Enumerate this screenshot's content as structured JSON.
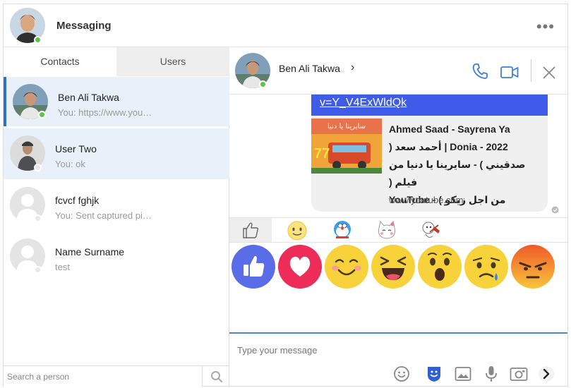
{
  "app": {
    "title": "Messaging",
    "more_icon": "more-horizontal-icon"
  },
  "tabs": [
    {
      "label": "Contacts",
      "active": true
    },
    {
      "label": "Users",
      "active": false
    }
  ],
  "contacts": [
    {
      "name": "Ben Ali Takwa",
      "preview": "You: https://www.you…",
      "status": "online"
    },
    {
      "name": "User Two",
      "preview": "You: ok",
      "status": "offline"
    },
    {
      "name": "fcvcf fghjk",
      "preview": "You: Sent captured pi…",
      "status": "offline"
    },
    {
      "name": "Name Surname",
      "preview": "test",
      "status": "offline"
    }
  ],
  "search": {
    "placeholder": "Search a person",
    "icon": "search-icon"
  },
  "chat": {
    "peer_name": "Ben Ali Takwa",
    "chevron": "›",
    "icons": [
      "phone-icon",
      "video-icon",
      "close-icon"
    ]
  },
  "message": {
    "link_text": "v=Y_V4ExWldQk",
    "preview_title": "Ahmed Saad - Sayrena Ya Donia - 2022 | أحمد سعد ( صدقيني ) - سايرينا يا دنيا من فيلم ( من اجل زيكو ) - YouTube",
    "preview_title_lines": [
      "Ahmed Saad - Sayrena Ya",
      "Donia - 2022 | أحمد سعد (",
      "صدقيني ) - سايرينا يا دنيا من فيلم (",
      "من اجل زيكو ) - YouTube"
    ],
    "preview_domain": "www.youtube.com",
    "thumbnail_text": "سايرينا يا دنيا",
    "thumbnail_number": "77"
  },
  "sticker_tabs": [
    "like-icon",
    "smiley-sticker",
    "doraemon-sticker",
    "cat-sticker",
    "character-sticker"
  ],
  "reactions": [
    {
      "name": "like",
      "color": "#5a6de8"
    },
    {
      "name": "love",
      "color": "#ee2c5a"
    },
    {
      "name": "haha-blush",
      "color": "#f7d23a"
    },
    {
      "name": "laugh",
      "color": "#f7d23a"
    },
    {
      "name": "wow",
      "color": "#f7d23a"
    },
    {
      "name": "sad",
      "color": "#f7d23a"
    },
    {
      "name": "angry",
      "color": "#f07a2a"
    }
  ],
  "composer": {
    "placeholder": "Type your message",
    "tools": [
      "emoji-icon",
      "sticker-icon",
      "image-icon",
      "microphone-icon",
      "camera-icon",
      "send-icon"
    ]
  },
  "colors": {
    "accent": "#2e73c7",
    "online": "#5ec34a",
    "link_strip": "#3e5ce8"
  }
}
